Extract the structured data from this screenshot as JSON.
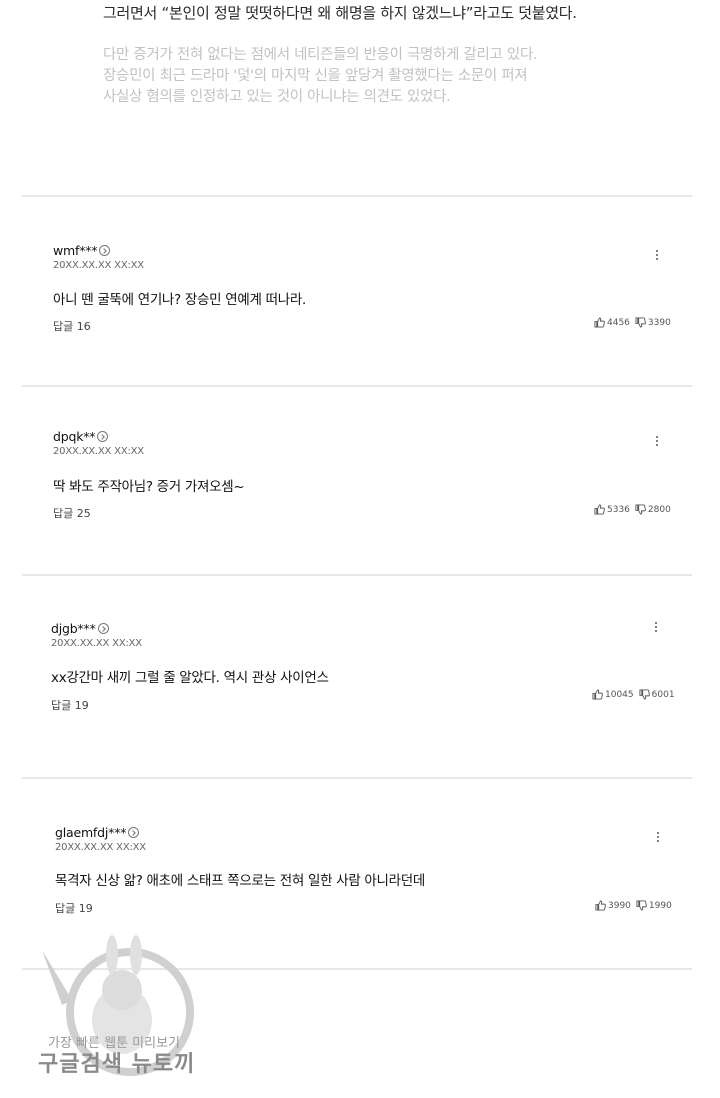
{
  "article": {
    "quote": "그러면서 “본인이 정말 떳떳하다면 왜 해명을 하지 않겠느냐”라고도 덧붙였다.",
    "lines": [
      "다만 증거가 전혀 없다는 점에서 네티즌들의 반응이 극명하게 갈리고 있다.",
      "장승민이 최근 드라마 '덫'의 마지막 신을 앞당겨 촬영했다는 소문이 퍼져",
      "사실상 혐의를 인정하고 있는 것이 아니냐는 의견도 있었다."
    ]
  },
  "comments": [
    {
      "user": "wmf***",
      "date": "20XX.XX.XX XX:XX",
      "text": "아니 뗀 굴뚝에 연기나? 장승민 연예계 떠나라.",
      "reply": "답글 16",
      "likes": "4456",
      "dislikes": "3390"
    },
    {
      "user": "dpqk**",
      "date": "20XX.XX.XX XX:XX",
      "text": "딱 봐도 주작아님? 증거 가져오셈~",
      "reply": "답글 25",
      "likes": "5336",
      "dislikes": "2800"
    },
    {
      "user": "djgb***",
      "date": "20XX.XX.XX XX:XX",
      "text": "xx강간마 새끼 그럴 줄 알았다. 역시 관상 사이언스",
      "reply": "답글 19",
      "likes": "10045",
      "dislikes": "6001"
    },
    {
      "user": "glaemfdj***",
      "date": "20XX.XX.XX XX:XX",
      "text": "목격자 신상 앎? 애초에 스태프 쪽으로는 전혀 일한 사람 아니라던데",
      "reply": "답글 19",
      "likes": "3990",
      "dislikes": "1990"
    }
  ],
  "watermark": {
    "line1": "가장 빠른 웹툰 미리보기",
    "line2": "구글검색 뉴토끼"
  },
  "icons": {
    "profile": "chevron-circle-icon",
    "more": "more-vertical-icon",
    "like": "thumbs-up-icon",
    "dislike": "thumbs-down-icon"
  }
}
